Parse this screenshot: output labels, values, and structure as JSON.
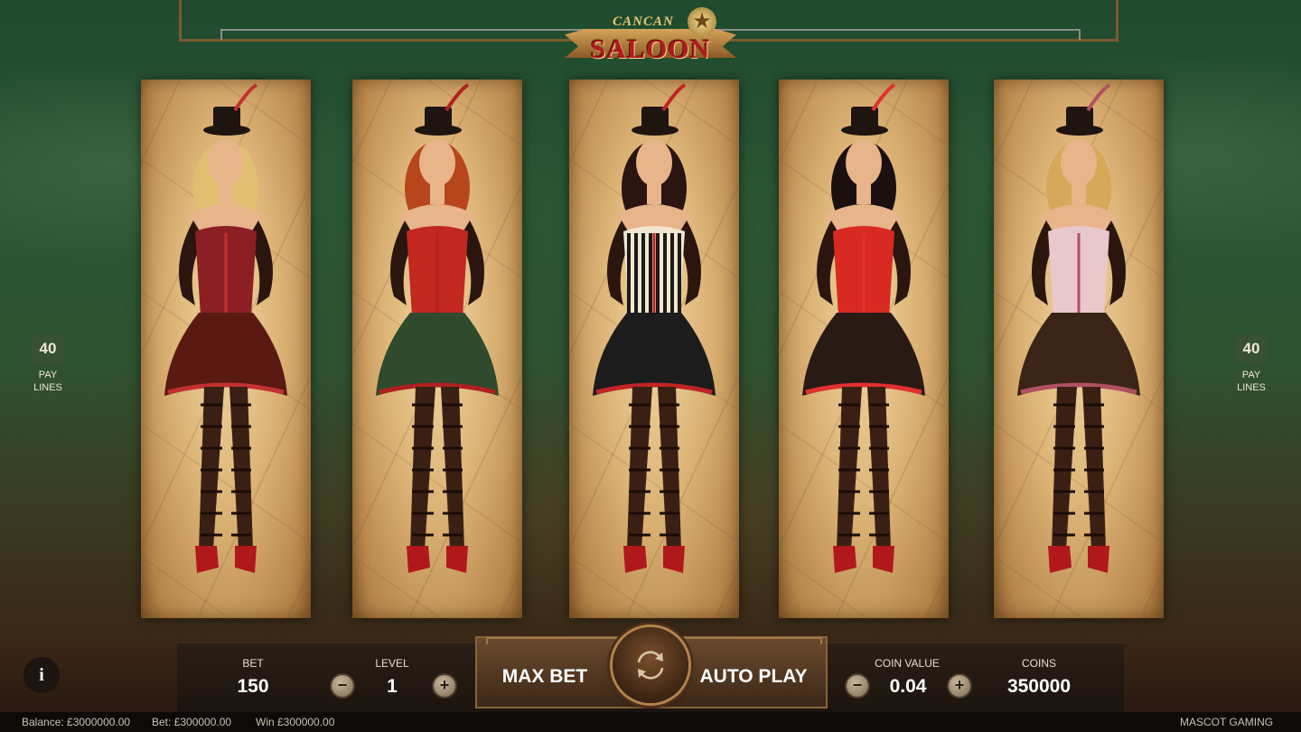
{
  "logo": {
    "line1": "CANCAN",
    "line2": "SALOON",
    "star": "★"
  },
  "paylines": {
    "count": "40",
    "label_line1": "PAY",
    "label_line2": "LINES"
  },
  "reels": [
    {
      "corset": "#8c1f24",
      "skirt": "#5a1a12",
      "accent": "#c23030",
      "hair": "#e0c070",
      "stripe": false
    },
    {
      "corset": "#c2281f",
      "skirt": "#2f4a2c",
      "accent": "#b02020",
      "hair": "#b8461c",
      "stripe": false
    },
    {
      "corset": "#f2e6d0",
      "skirt": "#1c1c1c",
      "accent": "#c02424",
      "hair": "#2a1410",
      "stripe": true
    },
    {
      "corset": "#d82a22",
      "skirt": "#2a1a16",
      "accent": "#e03030",
      "hair": "#1a1010",
      "stripe": false
    },
    {
      "corset": "#e8c8cc",
      "skirt": "#3a2418",
      "accent": "#b05060",
      "hair": "#d8a85a",
      "stripe": false
    }
  ],
  "controls": {
    "bet_label": "BET",
    "bet_value": "150",
    "level_label": "LEVEL",
    "level_value": "1",
    "max_bet": "MAX BET",
    "auto_play": "AUTO PLAY",
    "coin_value_label": "COIN VALUE",
    "coin_value": "0.04",
    "coins_label": "COINS",
    "coins_value": "350000",
    "minus": "−",
    "plus": "+",
    "info": "i"
  },
  "status": {
    "balance": "Balance: £3000000.00",
    "bet": "Bet: £300000.00",
    "win": "Win £300000.00",
    "brand": "MASCOT GAMING"
  },
  "colors": {
    "gold": "#b4834a",
    "panel": "#1c140f"
  }
}
